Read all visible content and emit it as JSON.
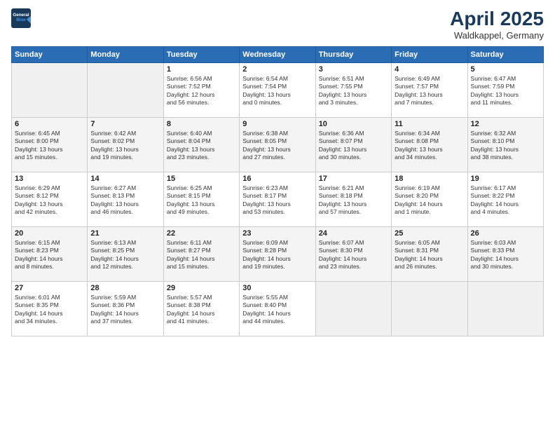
{
  "logo": {
    "line1": "General",
    "line2": "Blue"
  },
  "title": "April 2025",
  "subtitle": "Waldkappel, Germany",
  "weekdays": [
    "Sunday",
    "Monday",
    "Tuesday",
    "Wednesday",
    "Thursday",
    "Friday",
    "Saturday"
  ],
  "weeks": [
    [
      {
        "day": "",
        "info": ""
      },
      {
        "day": "",
        "info": ""
      },
      {
        "day": "1",
        "info": "Sunrise: 6:56 AM\nSunset: 7:52 PM\nDaylight: 12 hours\nand 56 minutes."
      },
      {
        "day": "2",
        "info": "Sunrise: 6:54 AM\nSunset: 7:54 PM\nDaylight: 13 hours\nand 0 minutes."
      },
      {
        "day": "3",
        "info": "Sunrise: 6:51 AM\nSunset: 7:55 PM\nDaylight: 13 hours\nand 3 minutes."
      },
      {
        "day": "4",
        "info": "Sunrise: 6:49 AM\nSunset: 7:57 PM\nDaylight: 13 hours\nand 7 minutes."
      },
      {
        "day": "5",
        "info": "Sunrise: 6:47 AM\nSunset: 7:59 PM\nDaylight: 13 hours\nand 11 minutes."
      }
    ],
    [
      {
        "day": "6",
        "info": "Sunrise: 6:45 AM\nSunset: 8:00 PM\nDaylight: 13 hours\nand 15 minutes."
      },
      {
        "day": "7",
        "info": "Sunrise: 6:42 AM\nSunset: 8:02 PM\nDaylight: 13 hours\nand 19 minutes."
      },
      {
        "day": "8",
        "info": "Sunrise: 6:40 AM\nSunset: 8:04 PM\nDaylight: 13 hours\nand 23 minutes."
      },
      {
        "day": "9",
        "info": "Sunrise: 6:38 AM\nSunset: 8:05 PM\nDaylight: 13 hours\nand 27 minutes."
      },
      {
        "day": "10",
        "info": "Sunrise: 6:36 AM\nSunset: 8:07 PM\nDaylight: 13 hours\nand 30 minutes."
      },
      {
        "day": "11",
        "info": "Sunrise: 6:34 AM\nSunset: 8:08 PM\nDaylight: 13 hours\nand 34 minutes."
      },
      {
        "day": "12",
        "info": "Sunrise: 6:32 AM\nSunset: 8:10 PM\nDaylight: 13 hours\nand 38 minutes."
      }
    ],
    [
      {
        "day": "13",
        "info": "Sunrise: 6:29 AM\nSunset: 8:12 PM\nDaylight: 13 hours\nand 42 minutes."
      },
      {
        "day": "14",
        "info": "Sunrise: 6:27 AM\nSunset: 8:13 PM\nDaylight: 13 hours\nand 46 minutes."
      },
      {
        "day": "15",
        "info": "Sunrise: 6:25 AM\nSunset: 8:15 PM\nDaylight: 13 hours\nand 49 minutes."
      },
      {
        "day": "16",
        "info": "Sunrise: 6:23 AM\nSunset: 8:17 PM\nDaylight: 13 hours\nand 53 minutes."
      },
      {
        "day": "17",
        "info": "Sunrise: 6:21 AM\nSunset: 8:18 PM\nDaylight: 13 hours\nand 57 minutes."
      },
      {
        "day": "18",
        "info": "Sunrise: 6:19 AM\nSunset: 8:20 PM\nDaylight: 14 hours\nand 1 minute."
      },
      {
        "day": "19",
        "info": "Sunrise: 6:17 AM\nSunset: 8:22 PM\nDaylight: 14 hours\nand 4 minutes."
      }
    ],
    [
      {
        "day": "20",
        "info": "Sunrise: 6:15 AM\nSunset: 8:23 PM\nDaylight: 14 hours\nand 8 minutes."
      },
      {
        "day": "21",
        "info": "Sunrise: 6:13 AM\nSunset: 8:25 PM\nDaylight: 14 hours\nand 12 minutes."
      },
      {
        "day": "22",
        "info": "Sunrise: 6:11 AM\nSunset: 8:27 PM\nDaylight: 14 hours\nand 15 minutes."
      },
      {
        "day": "23",
        "info": "Sunrise: 6:09 AM\nSunset: 8:28 PM\nDaylight: 14 hours\nand 19 minutes."
      },
      {
        "day": "24",
        "info": "Sunrise: 6:07 AM\nSunset: 8:30 PM\nDaylight: 14 hours\nand 23 minutes."
      },
      {
        "day": "25",
        "info": "Sunrise: 6:05 AM\nSunset: 8:31 PM\nDaylight: 14 hours\nand 26 minutes."
      },
      {
        "day": "26",
        "info": "Sunrise: 6:03 AM\nSunset: 8:33 PM\nDaylight: 14 hours\nand 30 minutes."
      }
    ],
    [
      {
        "day": "27",
        "info": "Sunrise: 6:01 AM\nSunset: 8:35 PM\nDaylight: 14 hours\nand 34 minutes."
      },
      {
        "day": "28",
        "info": "Sunrise: 5:59 AM\nSunset: 8:36 PM\nDaylight: 14 hours\nand 37 minutes."
      },
      {
        "day": "29",
        "info": "Sunrise: 5:57 AM\nSunset: 8:38 PM\nDaylight: 14 hours\nand 41 minutes."
      },
      {
        "day": "30",
        "info": "Sunrise: 5:55 AM\nSunset: 8:40 PM\nDaylight: 14 hours\nand 44 minutes."
      },
      {
        "day": "",
        "info": ""
      },
      {
        "day": "",
        "info": ""
      },
      {
        "day": "",
        "info": ""
      }
    ]
  ]
}
